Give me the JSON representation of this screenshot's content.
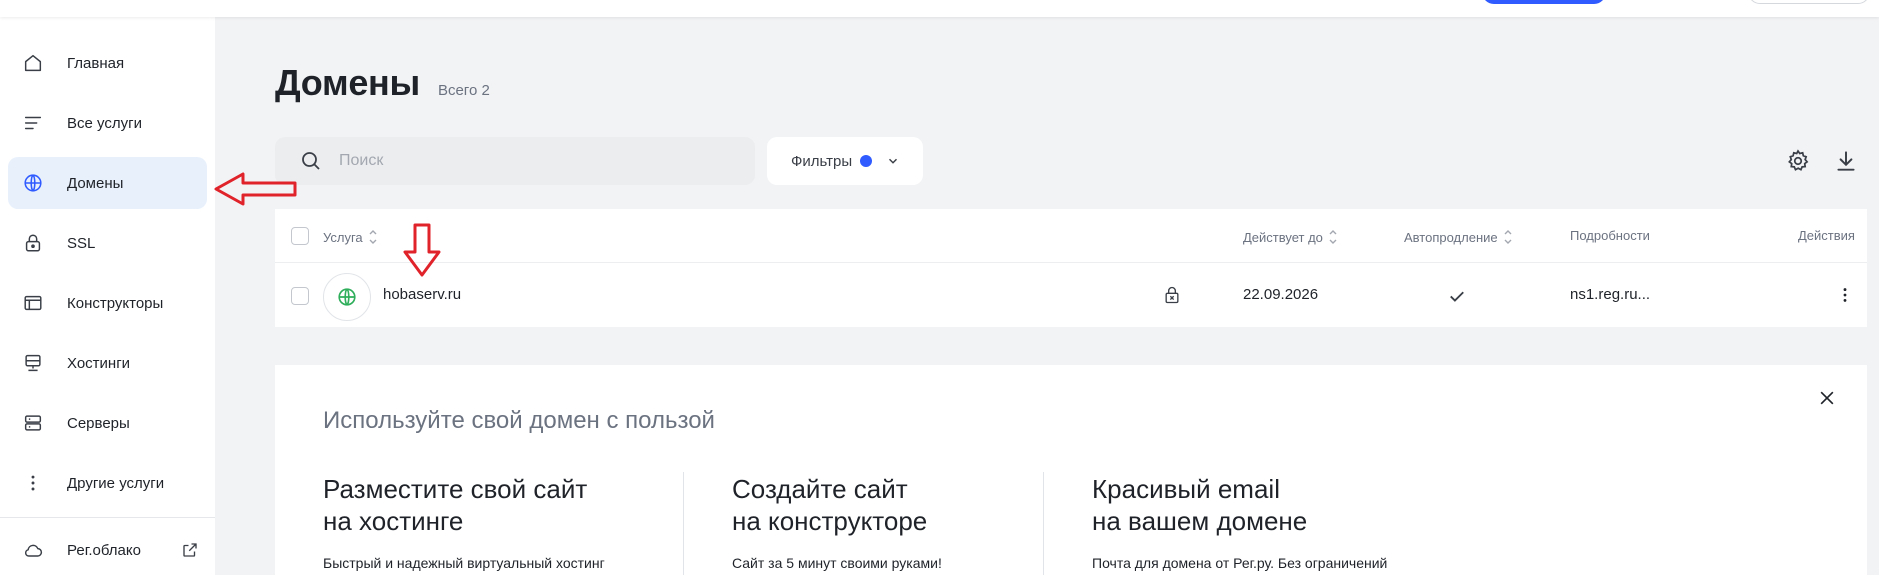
{
  "sidebar": {
    "items": [
      {
        "label": "Главная",
        "icon": "home-icon"
      },
      {
        "label": "Все услуги",
        "icon": "list-icon"
      },
      {
        "label": "Домены",
        "icon": "globe-icon"
      },
      {
        "label": "SSL",
        "icon": "lock-icon"
      },
      {
        "label": "Конструкторы",
        "icon": "browser-window-icon"
      },
      {
        "label": "Хостинги",
        "icon": "hosting-icon"
      },
      {
        "label": "Серверы",
        "icon": "server-icon"
      },
      {
        "label": "Другие услуги",
        "icon": "more-vertical-icon"
      }
    ],
    "bottom": {
      "label": "Рег.облако",
      "icon": "cloud-icon"
    }
  },
  "page": {
    "title": "Домены",
    "total": "Всего 2"
  },
  "search": {
    "placeholder": "Поиск"
  },
  "filters": {
    "label": "Фильтры"
  },
  "table": {
    "headers": {
      "service": "Услуга",
      "valid_until": "Действует до",
      "auto_renew": "Автопродление",
      "details": "Подробности",
      "actions": "Действия"
    },
    "rows": [
      {
        "domain": "hobaserv.ru",
        "valid_until": "22.09.2026",
        "auto_renew": true,
        "details": "ns1.reg.ru..."
      }
    ]
  },
  "promo": {
    "title": "Используйте свой домен с пользой",
    "cards": [
      {
        "line1": "Разместите свой сайт",
        "line2": "на хостинге",
        "text": "Быстрый и надежный виртуальный хостинг"
      },
      {
        "line1": "Создайте сайт",
        "line2": "на конструкторе",
        "text": "Сайт за 5 минут своими руками!"
      },
      {
        "line1": "Красивый email",
        "line2": "на вашем домене",
        "text": "Почта для домена от Рег.ру. Без ограничений"
      }
    ]
  },
  "colors": {
    "accent": "#2f5bff",
    "active_bg": "#e8f0fc",
    "annotation": "#e0222a",
    "domain_icon": "#2fae5b"
  }
}
